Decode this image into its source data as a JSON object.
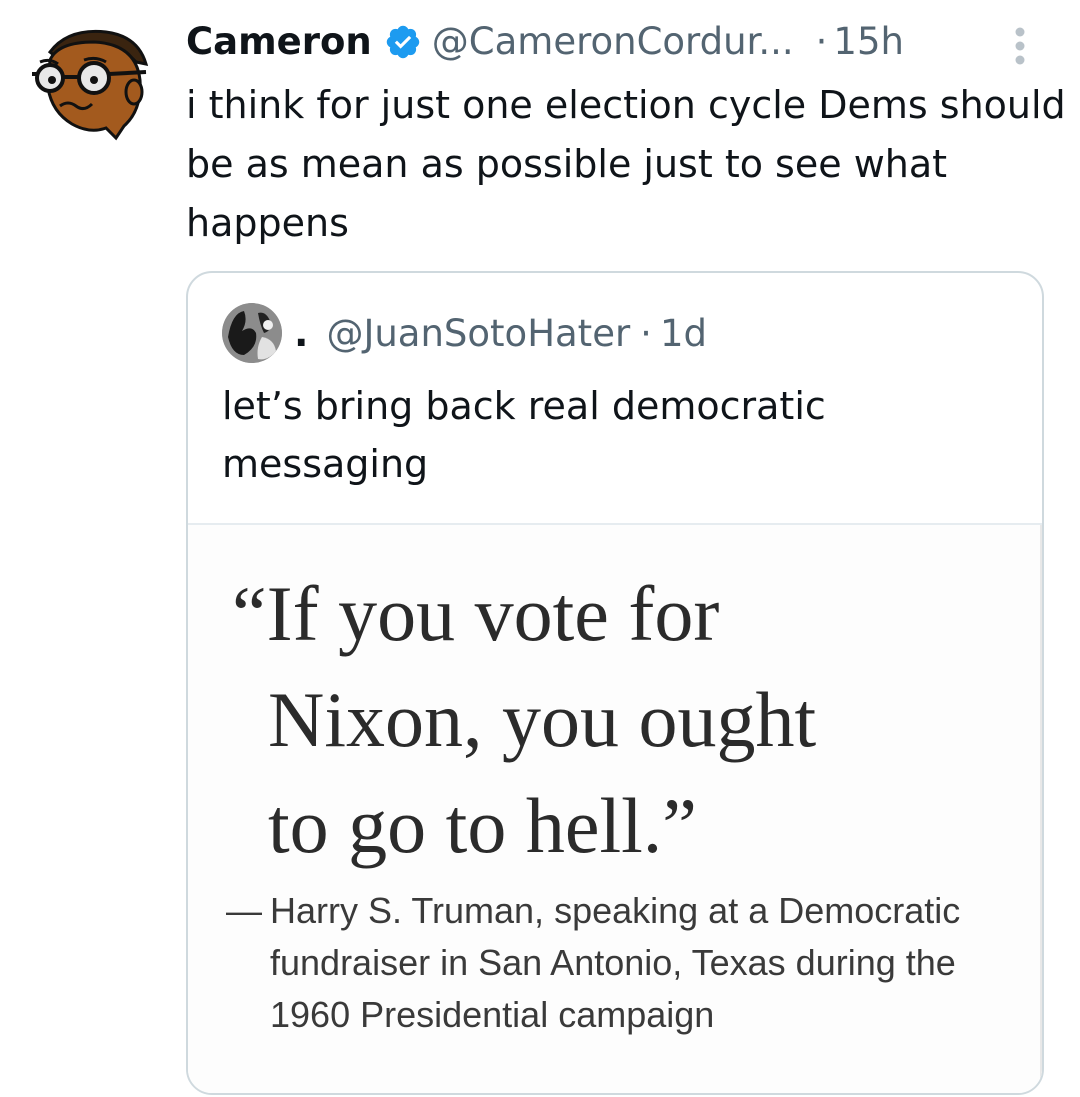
{
  "tweet": {
    "display_name": "Cameron",
    "handle": "@CameronCordur...",
    "separator": "·",
    "time": "15h",
    "text": "i think for just one election cycle Dems should be as mean as possible just to see what happens",
    "verified_color": "#1d9bf0",
    "icons": {
      "avatar": "cartoon-avatar",
      "verified": "verified-badge-icon",
      "more": "more-vertical-icon"
    }
  },
  "quoted_tweet": {
    "display_name": ".",
    "handle": "@JuanSotoHater",
    "separator": "·",
    "time": "1d",
    "text": "let’s bring back real democratic messaging",
    "image": {
      "quote_lines": [
        "“If you vote for",
        "Nixon, you ought",
        "to go to hell.”"
      ],
      "attribution_dash": "—",
      "attribution": "Harry S. Truman, speaking at a Democratic fundraiser in San Antonio, Texas during the 1960 Presidential campaign"
    }
  }
}
